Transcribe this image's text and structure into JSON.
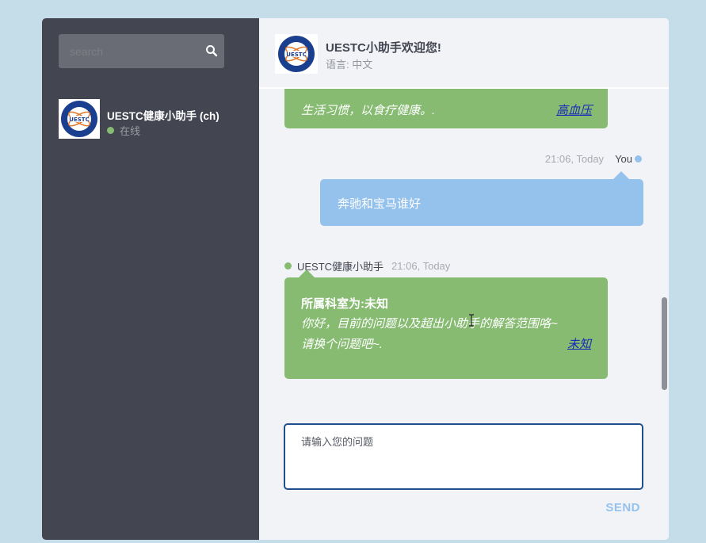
{
  "search": {
    "placeholder": "search"
  },
  "contact": {
    "name": "UESTC健康小助手 (ch)",
    "status": "在线"
  },
  "header": {
    "title": "UESTC小助手欢迎您!",
    "language": "语言: 中文"
  },
  "messages": [
    {
      "from": "assistant",
      "text": "生活习惯，以食疗健康。.",
      "link": "高血压"
    },
    {
      "from": "user",
      "sender": "You",
      "time": "21:06, Today",
      "text": "奔驰和宝马谁好"
    },
    {
      "from": "assistant",
      "sender": "UESTC健康小助手",
      "time": "21:06, Today",
      "heading": "所属科室为:未知",
      "line1": "你好，目前的问题以及超出小助手的解答范围咯~",
      "line2": "请换个问题吧~.",
      "link": "未知"
    }
  ],
  "composer": {
    "placeholder": "请输入您的问题",
    "send_label": "SEND"
  },
  "colors": {
    "assistant_bubble": "#86bb71",
    "user_bubble": "#94c2ed",
    "sidebar": "#434651",
    "online": "#86bb71"
  },
  "icons": {
    "search": "search-icon",
    "avatar": "uestc-logo",
    "cursor": "text-cursor-icon"
  }
}
